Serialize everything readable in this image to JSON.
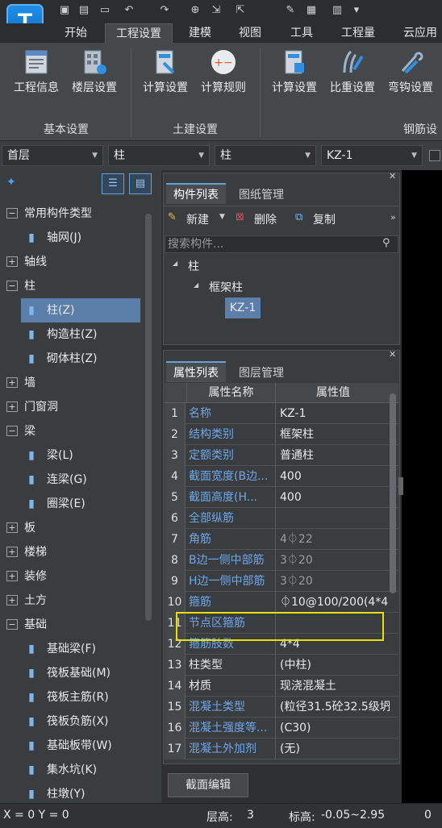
{
  "app": {
    "logo_letter": "T"
  },
  "quick_toolbar": [
    {
      "icon": "new-icon"
    },
    {
      "icon": "save-icon"
    },
    {
      "icon": "open-icon"
    },
    {
      "icon": "undo-icon"
    },
    {
      "icon": "redo-icon"
    },
    {
      "icon": "snap-icon"
    },
    {
      "icon": "import-icon"
    },
    {
      "icon": "export-icon"
    },
    {
      "icon": "brush-icon"
    },
    {
      "icon": "grid-icon"
    },
    {
      "icon": "ruler-icon"
    },
    {
      "icon": "customize-icon"
    }
  ],
  "tabs": [
    "开始",
    "工程设置",
    "建模",
    "视图",
    "工具",
    "工程量",
    "云应用"
  ],
  "active_tab": "工程设置",
  "ribbon": {
    "buttons": [
      "工程信息",
      "楼层设置",
      "计算设置",
      "计算规则",
      "计算设置",
      "比重设置",
      "弯钩设置"
    ],
    "groups": [
      "基本设置",
      "土建设置",
      "钢筋设"
    ]
  },
  "selectors": [
    "首层",
    "柱",
    "柱",
    "KZ-1"
  ],
  "tree": [
    {
      "label": "常用构件类型",
      "type": "group",
      "expanded": true
    },
    {
      "label": "轴网(J)",
      "type": "item",
      "icon": "axis-grid-icon"
    },
    {
      "label": "轴线",
      "type": "group",
      "expanded": false
    },
    {
      "label": "柱",
      "type": "group",
      "expanded": true
    },
    {
      "label": "柱(Z)",
      "type": "item",
      "icon": "column-icon",
      "selected": true
    },
    {
      "label": "构造柱(Z)",
      "type": "item",
      "icon": "constructional-column-icon"
    },
    {
      "label": "砌体柱(Z)",
      "type": "item",
      "icon": "masonry-column-icon"
    },
    {
      "label": "墙",
      "type": "group",
      "expanded": false
    },
    {
      "label": "门窗洞",
      "type": "group",
      "expanded": false
    },
    {
      "label": "梁",
      "type": "group",
      "expanded": true
    },
    {
      "label": "梁(L)",
      "type": "item",
      "icon": "beam-icon"
    },
    {
      "label": "连梁(G)",
      "type": "item",
      "icon": "coupling-beam-icon"
    },
    {
      "label": "圈梁(E)",
      "type": "item",
      "icon": "ring-beam-icon"
    },
    {
      "label": "板",
      "type": "group",
      "expanded": false
    },
    {
      "label": "楼梯",
      "type": "group",
      "expanded": false
    },
    {
      "label": "装修",
      "type": "group",
      "expanded": false
    },
    {
      "label": "土方",
      "type": "group",
      "expanded": false
    },
    {
      "label": "基础",
      "type": "group",
      "expanded": true
    },
    {
      "label": "基础梁(F)",
      "type": "item",
      "icon": "foundation-beam-icon"
    },
    {
      "label": "筏板基础(M)",
      "type": "item",
      "icon": "raft-foundation-icon"
    },
    {
      "label": "筏板主筋(R)",
      "type": "item",
      "icon": "raft-main-rebar-icon"
    },
    {
      "label": "筏板负筋(X)",
      "type": "item",
      "icon": "raft-negative-rebar-icon"
    },
    {
      "label": "基础板带(W)",
      "type": "item",
      "icon": "foundation-strip-icon"
    },
    {
      "label": "集水坑(K)",
      "type": "item",
      "icon": "sump-pit-icon"
    },
    {
      "label": "柱墩(Y)",
      "type": "item",
      "icon": "column-pier-icon"
    }
  ],
  "component_panel": {
    "tabs": [
      "构件列表",
      "图纸管理"
    ],
    "toolbar": {
      "new": "新建",
      "delete": "删除",
      "copy": "复制"
    },
    "search_placeholder": "搜索构件...",
    "tree": {
      "root": "柱",
      "child": "框架柱",
      "leaf": "KZ-1"
    }
  },
  "property_panel": {
    "tabs": [
      "属性列表",
      "图层管理"
    ],
    "headers": [
      "属性名称",
      "属性值"
    ],
    "rows": [
      {
        "n": "1",
        "name": "名称",
        "value": "KZ-1"
      },
      {
        "n": "2",
        "name": "结构类别",
        "value": "框架柱"
      },
      {
        "n": "3",
        "name": "定额类别",
        "value": "普通柱"
      },
      {
        "n": "4",
        "name": "截面宽度(B边...",
        "value": "400"
      },
      {
        "n": "5",
        "name": "截面高度(H...",
        "value": "400"
      },
      {
        "n": "6",
        "name": "全部纵筋",
        "value": ""
      },
      {
        "n": "7",
        "name": "角筋",
        "value": "4⏀22"
      },
      {
        "n": "8",
        "name": "B边一侧中部筋",
        "value": "3⏀20"
      },
      {
        "n": "9",
        "name": "H边一侧中部筋",
        "value": "3⏀20"
      },
      {
        "n": "10",
        "name": "箍筋",
        "value": "⏀10@100/200(4*4"
      },
      {
        "n": "11",
        "name": "节点区箍筋",
        "value": ""
      },
      {
        "n": "12",
        "name": "箍筋肢数",
        "value": "4*4"
      },
      {
        "n": "13",
        "name": "柱类型",
        "value": "(中柱)"
      },
      {
        "n": "14",
        "name": "材质",
        "value": "现浇混凝土"
      },
      {
        "n": "15",
        "name": "混凝土类型",
        "value": "(粒径31.5砼32.5级坍"
      },
      {
        "n": "16",
        "name": "混凝土强度等...",
        "value": "(C30)"
      },
      {
        "n": "17",
        "name": "混凝土外加剂",
        "value": "(无)"
      }
    ],
    "footer_button": "截面编辑"
  },
  "status": {
    "coords": "X = 0 Y = 0",
    "floor_height_label": "层高:",
    "floor_height": "3",
    "elevation_label": "标高:",
    "elevation": "-0.05~2.95",
    "extra": "0"
  },
  "colors": {
    "accent": "#1e90e6",
    "highlight_box": "#e8e000",
    "link": "#6fa6e6",
    "selected": "#5b7fa8"
  }
}
